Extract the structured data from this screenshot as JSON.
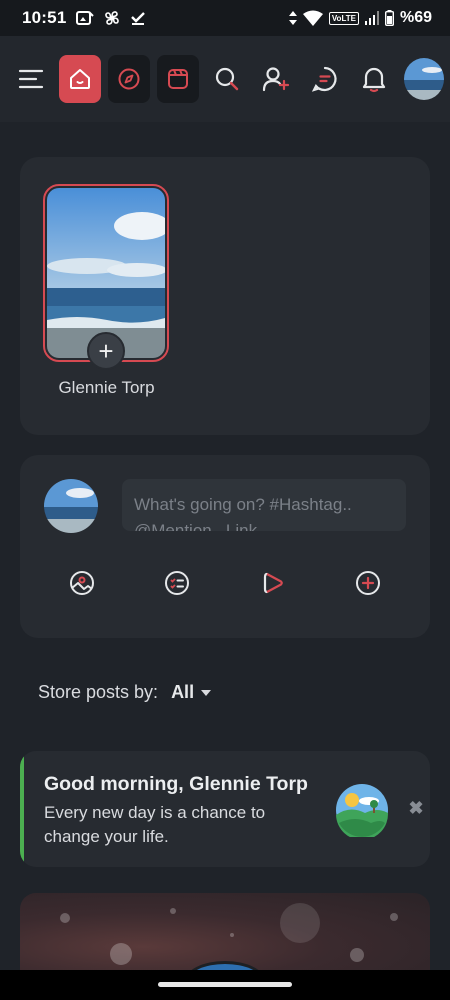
{
  "status_bar": {
    "time": "10:51",
    "network_badge": "VoLTE",
    "battery": "%69"
  },
  "nav": {
    "items": [
      "menu-icon",
      "home-icon",
      "explore-icon",
      "reels-icon",
      "search-icon",
      "add-user-icon",
      "messages-icon",
      "notifications-icon",
      "profile-avatar"
    ],
    "active": "home",
    "accent_color": "#d64a52"
  },
  "stories": {
    "user_name": "Glennie Torp",
    "add_label": "+"
  },
  "composer": {
    "placeholder": "What's going on? #Hashtag.. @Mention.. Link..",
    "actions": [
      "photo-icon",
      "poll-icon",
      "video-icon",
      "more-icon"
    ]
  },
  "sort": {
    "label": "Store posts by:",
    "value": "All"
  },
  "greeting": {
    "title": "Good morning, Glennie Torp",
    "message": "Every new day is a chance to change your life.",
    "close_label": "✖",
    "accent_color": "#4caf50"
  }
}
